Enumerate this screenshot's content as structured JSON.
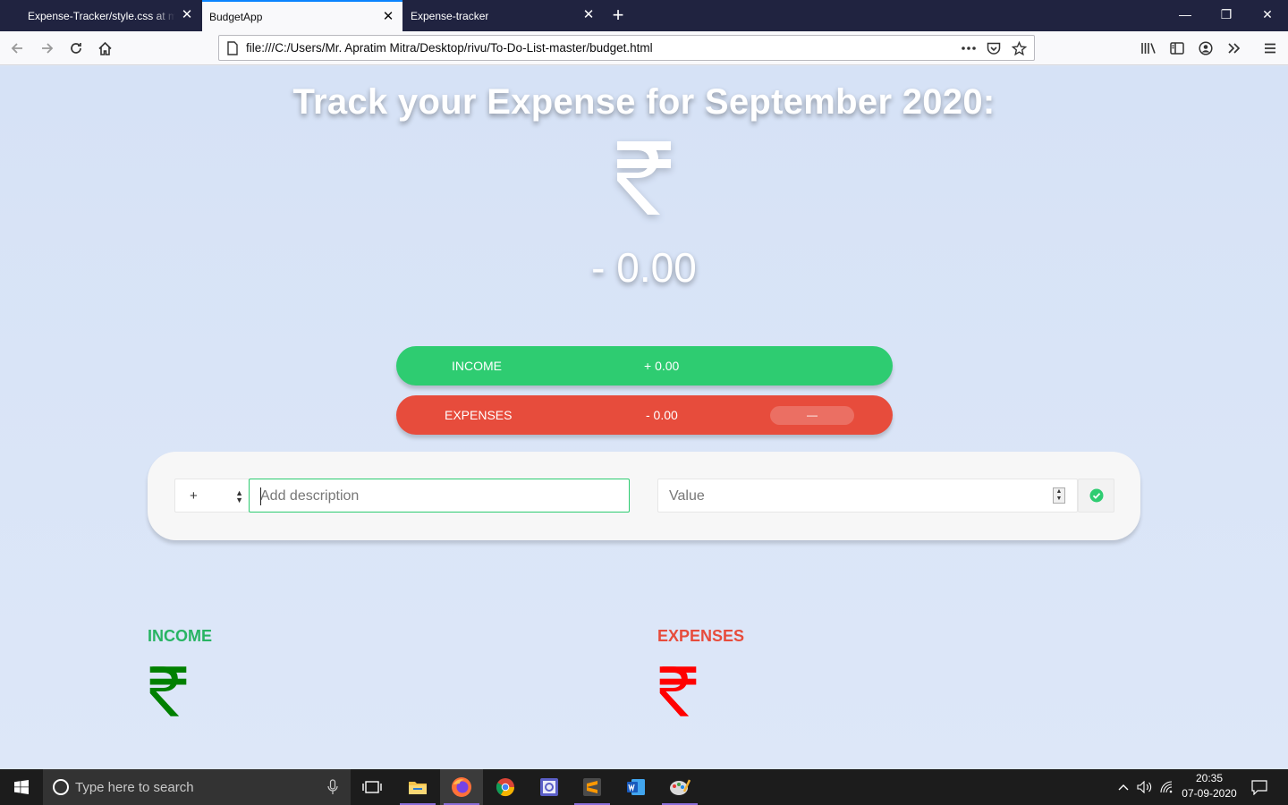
{
  "browser": {
    "tabs": [
      {
        "title": "Expense-Tracker/style.css at master",
        "active": false
      },
      {
        "title": "BudgetApp",
        "active": true
      },
      {
        "title": "Expense-tracker",
        "active": false
      }
    ],
    "new_tab_symbol": "+",
    "url": "file:///C:/Users/Mr. Apratim Mitra/Desktop/rivu/To-Do-List-master/budget.html"
  },
  "page": {
    "title": "Track your Expense for September 2020:",
    "currency_icon": "rupee-icon",
    "budget_value": "- 0.00",
    "income_summary": {
      "label": "INCOME",
      "value": "+ 0.00"
    },
    "expenses_summary": {
      "label": "EXPENSES",
      "value": "- 0.00",
      "percentage": "—"
    },
    "add_form": {
      "type_value": "+",
      "description_placeholder": "Add description",
      "value_placeholder": "Value"
    },
    "income_column": {
      "title": "INCOME"
    },
    "expenses_column": {
      "title": "EXPENSES"
    },
    "colors": {
      "income": "#2ecc71",
      "expense": "#e74c3c",
      "income_rupee": "#008000",
      "expense_rupee": "#ff0000"
    }
  },
  "taskbar": {
    "search_placeholder": "Type here to search",
    "time": "20:35",
    "date": "07-09-2020"
  }
}
